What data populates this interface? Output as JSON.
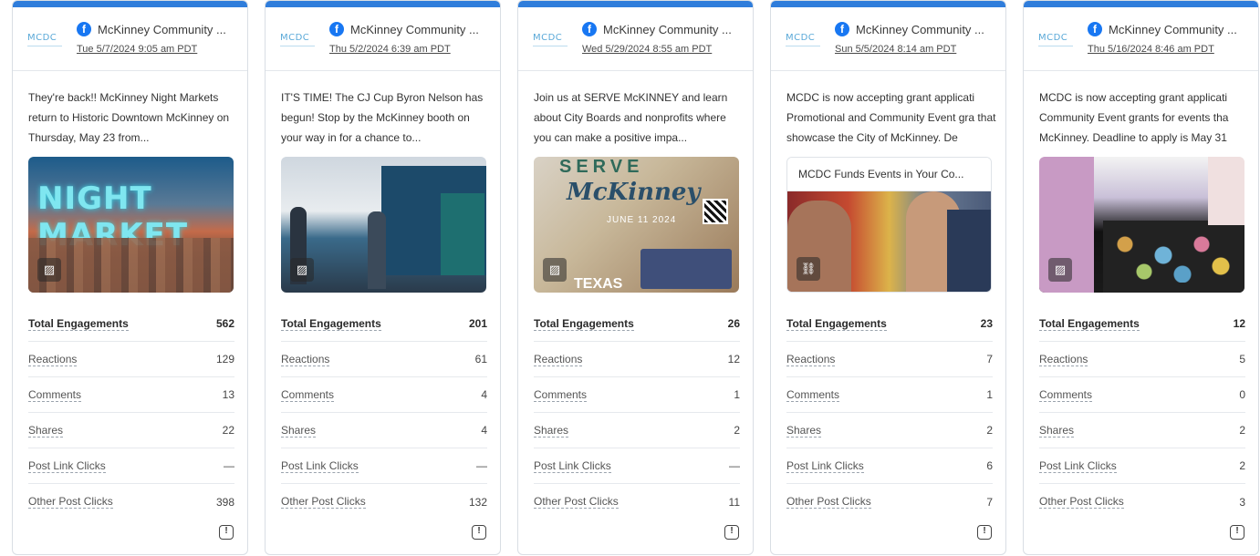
{
  "cards": [
    {
      "account": "McKinney Community ...",
      "logo_text": "MCDC",
      "date": "Tue 5/7/2024 9:05 am PDT",
      "text": "They're back!! McKinney Night Markets return to Historic Downtown McKinney on Thursday, May 23 from...",
      "media_icon": "image-icon",
      "metrics": [
        {
          "label": "Total Engagements",
          "value": "562"
        },
        {
          "label": "Reactions",
          "value": "129"
        },
        {
          "label": "Comments",
          "value": "13"
        },
        {
          "label": "Shares",
          "value": "22"
        },
        {
          "label": "Post Link Clicks",
          "value": "—"
        },
        {
          "label": "Other Post Clicks",
          "value": "398"
        }
      ]
    },
    {
      "account": "McKinney Community ...",
      "logo_text": "MCDC",
      "date": "Thu 5/2/2024 6:39 am PDT",
      "text": "IT'S TIME! The CJ Cup Byron Nelson has begun! Stop by the McKinney booth on your way in for a chance to...",
      "media_icon": "image-icon",
      "metrics": [
        {
          "label": "Total Engagements",
          "value": "201"
        },
        {
          "label": "Reactions",
          "value": "61"
        },
        {
          "label": "Comments",
          "value": "4"
        },
        {
          "label": "Shares",
          "value": "4"
        },
        {
          "label": "Post Link Clicks",
          "value": "—"
        },
        {
          "label": "Other Post Clicks",
          "value": "132"
        }
      ]
    },
    {
      "account": "McKinney Community ...",
      "logo_text": "MCDC",
      "date": "Wed 5/29/2024 8:55 am PDT",
      "text": "Join us at SERVE McKINNEY and learn about City Boards and nonprofits where you can make a positive impa...",
      "media_icon": "image-icon",
      "media_text": {
        "line1": "SERVE",
        "line2": "McKinney",
        "line3": "JUNE 11 2024",
        "line4": "TEXAS"
      },
      "metrics": [
        {
          "label": "Total Engagements",
          "value": "26"
        },
        {
          "label": "Reactions",
          "value": "12"
        },
        {
          "label": "Comments",
          "value": "1"
        },
        {
          "label": "Shares",
          "value": "2"
        },
        {
          "label": "Post Link Clicks",
          "value": "—"
        },
        {
          "label": "Other Post Clicks",
          "value": "11"
        }
      ]
    },
    {
      "account": "McKinney Community ...",
      "logo_text": "MCDC",
      "date": "Sun 5/5/2024 8:14 am PDT",
      "text": "MCDC is now accepting grant applicati Promotional and Community Event gra that showcase the City of McKinney. De",
      "link_title": "MCDC Funds Events in Your Co...",
      "media_icon": "link-icon",
      "metrics": [
        {
          "label": "Total Engagements",
          "value": "23"
        },
        {
          "label": "Reactions",
          "value": "7"
        },
        {
          "label": "Comments",
          "value": "1"
        },
        {
          "label": "Shares",
          "value": "2"
        },
        {
          "label": "Post Link Clicks",
          "value": "6"
        },
        {
          "label": "Other Post Clicks",
          "value": "7"
        }
      ]
    },
    {
      "account": "McKinney Community ...",
      "logo_text": "MCDC",
      "date": "Thu 5/16/2024 8:46 am PDT",
      "text": "MCDC is now accepting grant applicati Community Event grants for events tha McKinney. Deadline to apply is May 31",
      "media_icon": "image-icon",
      "metrics": [
        {
          "label": "Total Engagements",
          "value": "12"
        },
        {
          "label": "Reactions",
          "value": "5"
        },
        {
          "label": "Comments",
          "value": "0"
        },
        {
          "label": "Shares",
          "value": "2"
        },
        {
          "label": "Post Link Clicks",
          "value": "2"
        },
        {
          "label": "Other Post Clicks",
          "value": "3"
        }
      ]
    }
  ],
  "glyphs": {
    "facebook": "f",
    "image": "▨",
    "link": "⛓",
    "comment": "!"
  },
  "media1_text": "NIGHT MARKET"
}
